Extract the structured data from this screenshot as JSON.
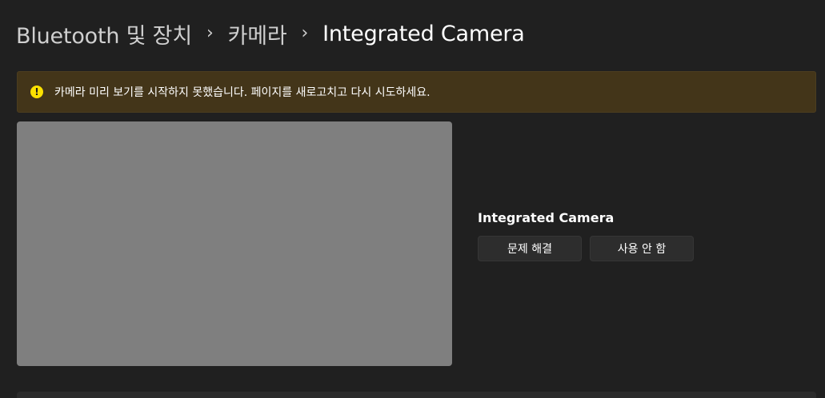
{
  "breadcrumb": {
    "parent": "Bluetooth 및 장치",
    "middle": "카메라",
    "current": "Integrated Camera",
    "separator": "›"
  },
  "infobar": {
    "icon": "warning-icon",
    "icon_glyph": "!",
    "message": "카메라 미리 보기를 시작하지 못했습니다. 페이지를 새로고치고 다시 시도하세요."
  },
  "camera": {
    "name": "Integrated Camera",
    "troubleshoot_label": "문제 해결",
    "disable_label": "사용 안 함"
  },
  "colors": {
    "background": "#202020",
    "infobar_bg": "#433519",
    "warning_icon": "#fce100",
    "preview_placeholder": "#7f7f7f",
    "button_bg": "#2d2d2d"
  }
}
